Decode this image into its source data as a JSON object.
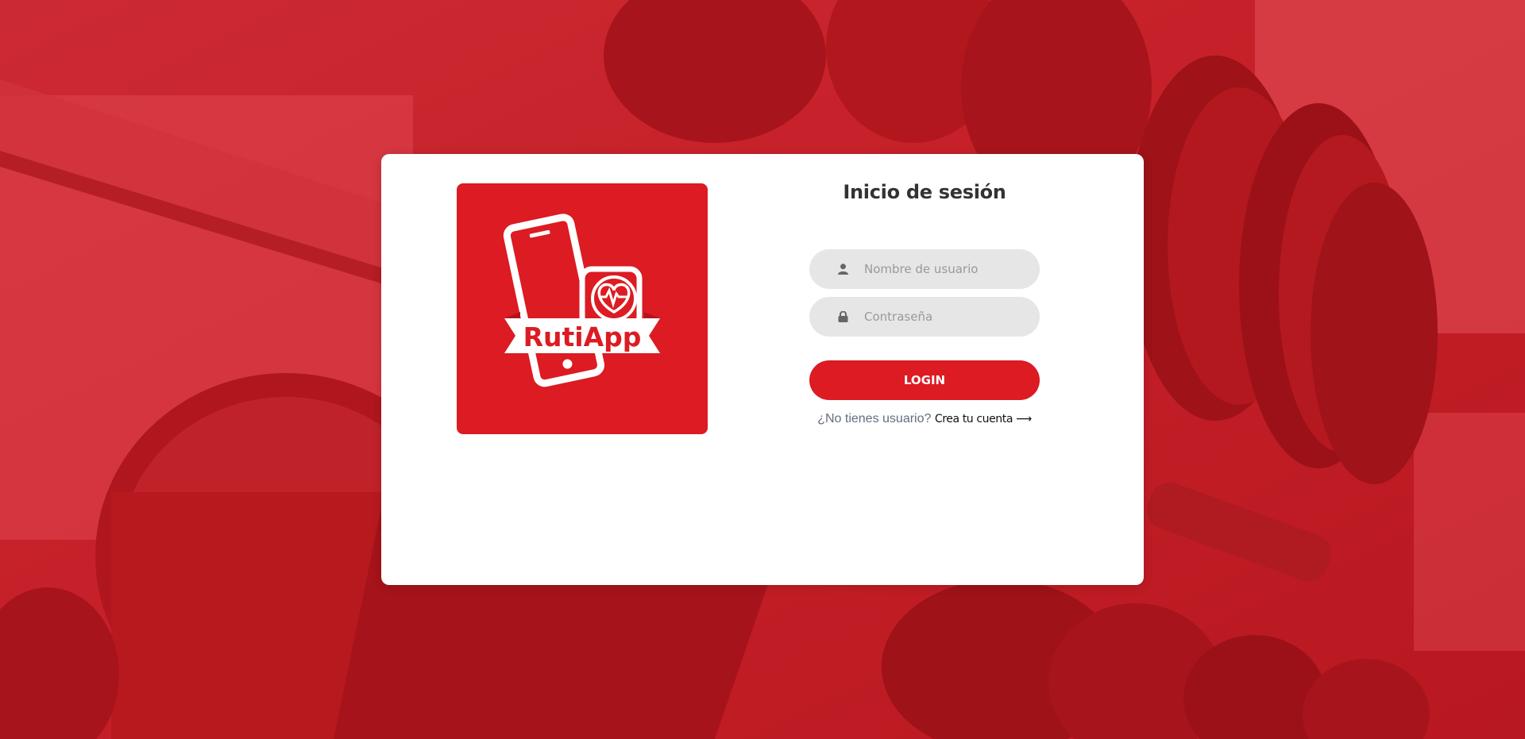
{
  "app": {
    "logo_text": "RutiApp"
  },
  "login": {
    "title": "Inicio de sesión",
    "username_placeholder": "Nombre de usuario",
    "password_placeholder": "Contraseña",
    "login_label": "LOGIN",
    "no_account_text": "¿No tienes usuario?",
    "create_account_label": "Crea tu cuenta",
    "create_account_arrow": "⟶"
  },
  "icons": {
    "username": "user-icon",
    "password": "lock-icon",
    "logo": "phone-heart-logo"
  },
  "colors": {
    "accent": "#dc1b22",
    "background_overlay": "#c81f28",
    "field_bg": "#e6e6e6",
    "card_bg": "#ffffff"
  }
}
